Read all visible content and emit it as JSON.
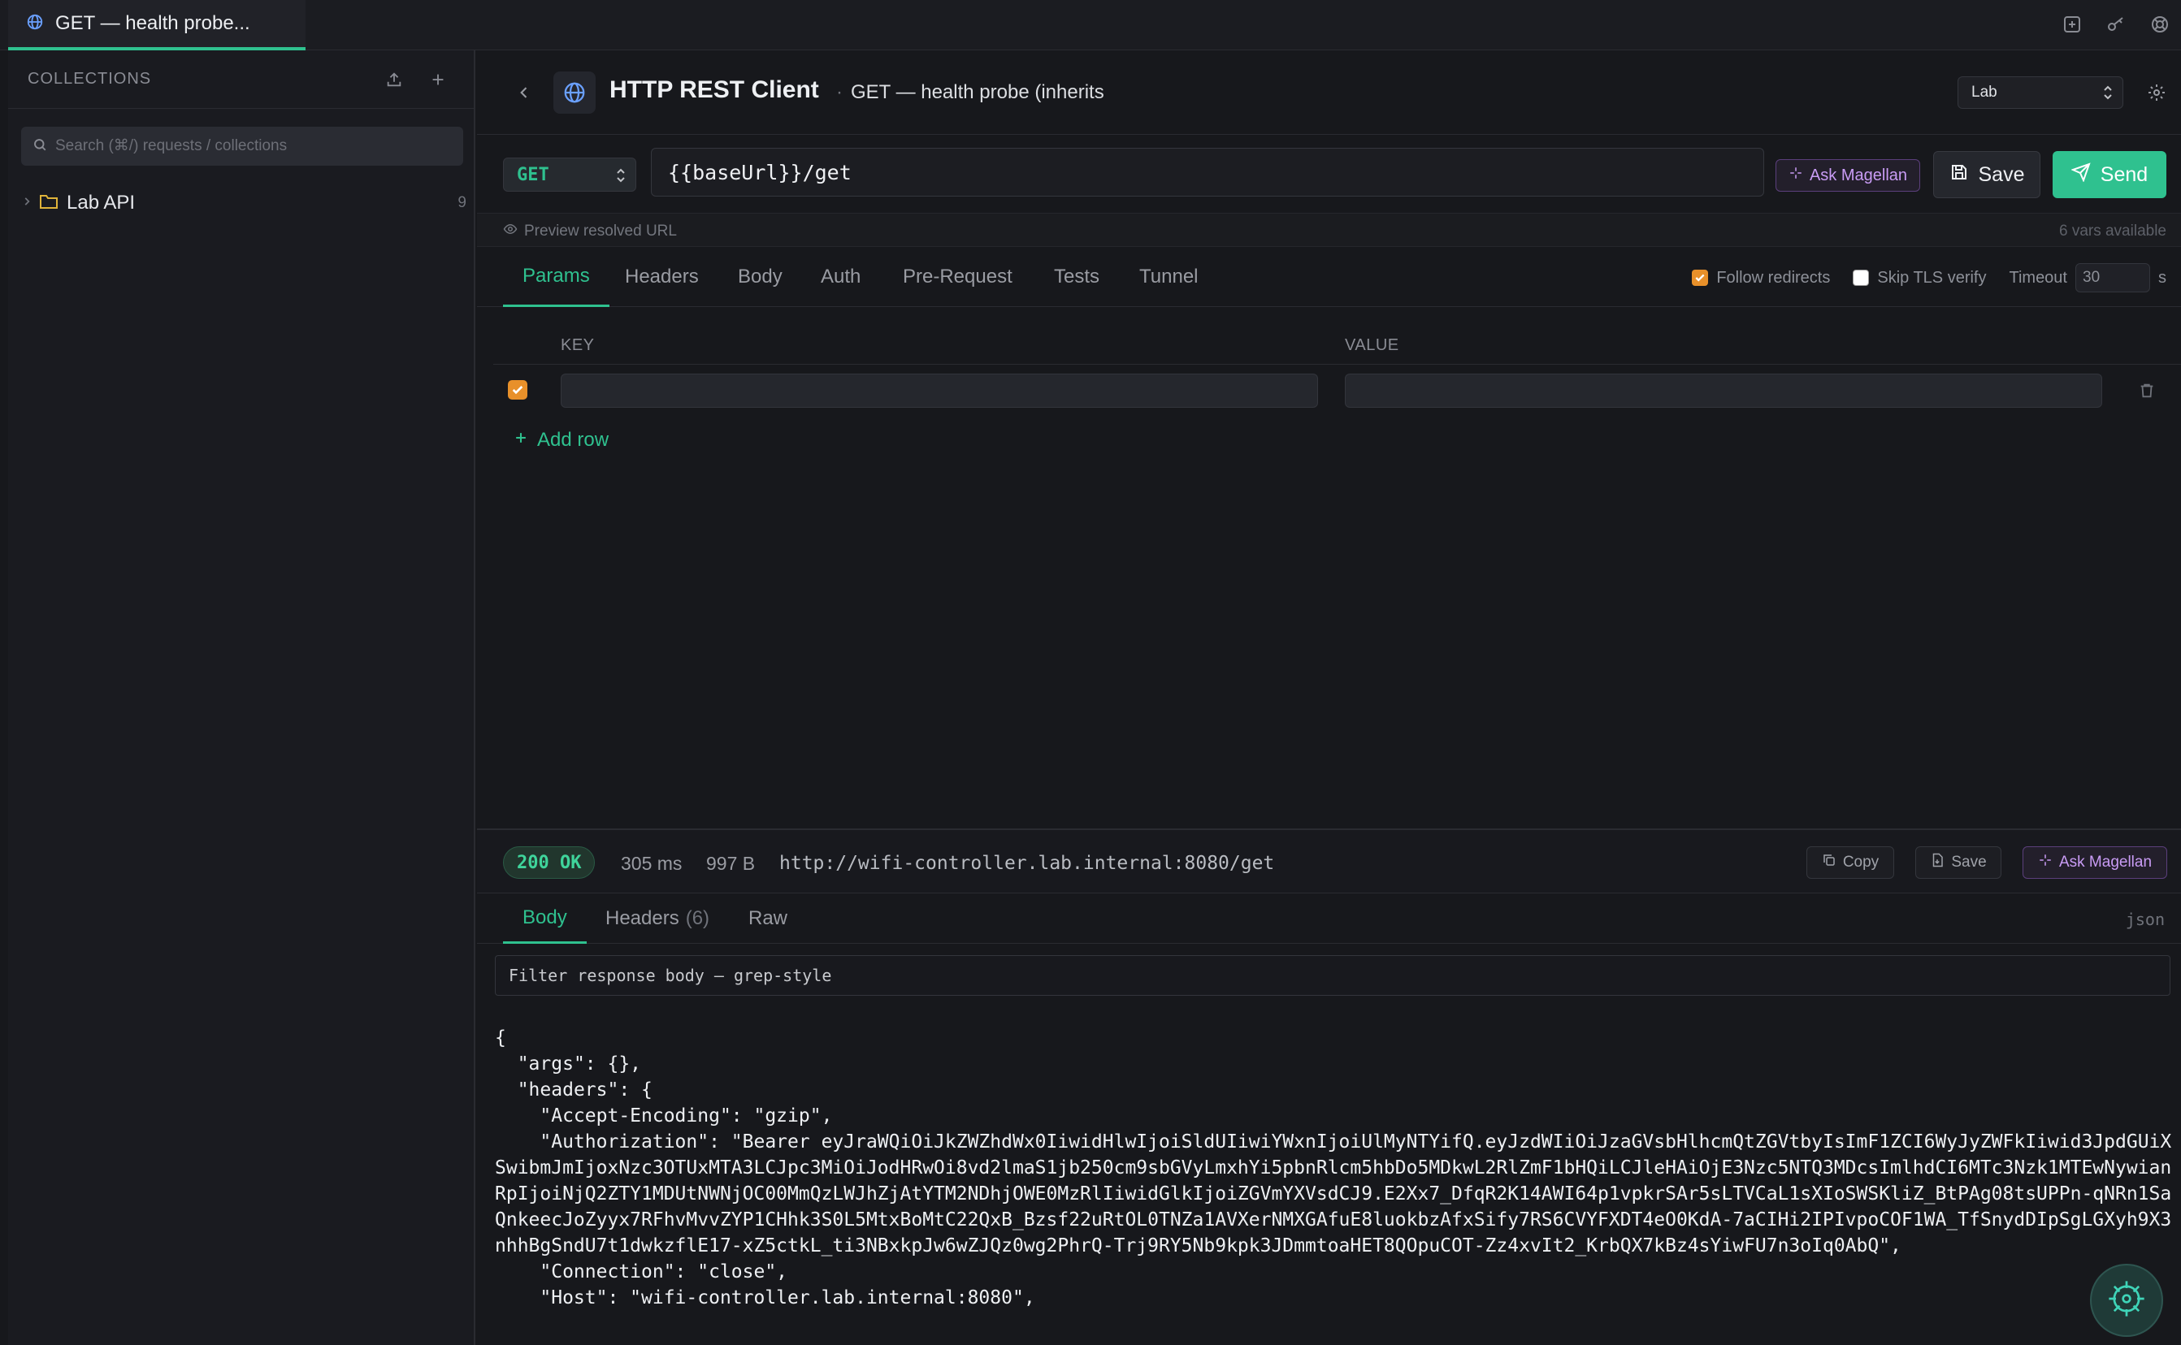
{
  "window": {
    "tab_title": "GET — health probe...",
    "icons": [
      "new-tab-icon",
      "key-icon",
      "help-icon"
    ]
  },
  "sidebar": {
    "title": "COLLECTIONS",
    "search_placeholder": "Search (⌘/) requests / collections",
    "folders": [
      {
        "name": "Lab API",
        "count": "9"
      }
    ]
  },
  "header": {
    "app_title": "HTTP REST Client",
    "request_name": "GET — health probe (inherits",
    "environment": "Lab"
  },
  "request": {
    "method": "GET",
    "url": "{{baseUrl}}/get",
    "ask_label": "Ask Magellan",
    "save_label": "Save",
    "send_label": "Send",
    "preview_label": "Preview resolved URL",
    "vars_available": "6 vars available"
  },
  "request_tabs": [
    "Params",
    "Headers",
    "Body",
    "Auth",
    "Pre-Request",
    "Tests",
    "Tunnel"
  ],
  "options": {
    "follow_redirects": "Follow redirects",
    "skip_tls": "Skip TLS verify",
    "timeout_label": "Timeout",
    "timeout_value": "30",
    "timeout_unit": "s"
  },
  "params": {
    "key_header": "KEY",
    "value_header": "VALUE",
    "add_row": "Add row"
  },
  "response": {
    "status": "200 OK",
    "time": "305 ms",
    "size": "997 B",
    "url": "http://wifi-controller.lab.internal:8080/get",
    "copy_label": "Copy",
    "save_label": "Save",
    "ask_label": "Ask Magellan",
    "tabs": {
      "body": "Body",
      "headers": "Headers",
      "headers_count": "(6)",
      "raw": "Raw"
    },
    "format": "json",
    "filter_placeholder": "Filter response body — grep-style",
    "body": "{\n  \"args\": {},\n  \"headers\": {\n    \"Accept-Encoding\": \"gzip\",\n    \"Authorization\": \"Bearer eyJraWQiOiJkZWZhdWx0IiwidHlwIjoiSldUIiwiYWxnIjoiUlMyNTYifQ.eyJzdWIiOiJzaGVsbHlhcmQtZGVtbyIsImF1ZCI6WyJyZWFkIiwid3JpdGUiXSwibmJmIjoxNzc3OTUxMTA3LCJpc3MiOiJodHRwOi8vd2lmaS1jb250cm9sbGVyLmxhYi5pbnRlcm5hbDo5MDkwL2RlZmF1bHQiLCJleHAiOjE3Nzc5NTQ3MDcsImlhdCI6MTc3Nzk1MTEwNywianRpIjoiNjQ2ZTY1MDUtNWNjOC00MmQzLWJhZjAtYTM2NDhjOWE0MzRlIiwidGlkIjoiZGVmYXVsdCJ9.E2Xx7_DfqR2K14AWI64p1vpkrSAr5sLTVCaL1sXIoSWSKliZ_BtPAg08tsUPPn-qNRn1SaQnkeecJoZyyx7RFhvMvvZYP1CHhk3S0L5MtxBoMtC22QxB_Bzsf22uRtOL0TNZa1AVXerNMXGAfuE8luokbzAfxSify7RS6CVYFXDT4eO0KdA-7aCIHi2IPIvpoCOF1WA_TfSnydDIpSgLGXyh9X3nhhBgSndU7t1dwkzflE17-xZ5ctkL_ti3NBxkpJw6wZJQz0wg2PhrQ-Trj9RY5Nb9kpk3JDmmtoaHET8QOpuCOT-Zz4xvIt2_KrbQX7kBz4sYiwFU7n3oIq0AbQ\",\n    \"Connection\": \"close\",\n    \"Host\": \"wifi-controller.lab.internal:8080\","
  },
  "colors": {
    "accent": "#2fc18f",
    "magellan": "#c99cf5",
    "checkbox": "#e8902a"
  }
}
